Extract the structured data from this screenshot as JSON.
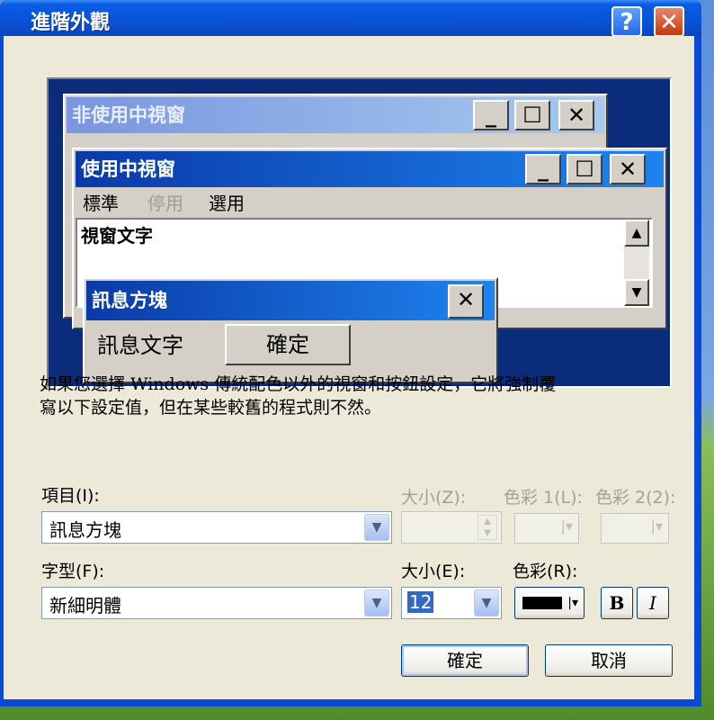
{
  "dialog": {
    "title": "進階外觀"
  },
  "preview": {
    "inactive_title": "非使用中視窗",
    "active_title": "使用中視窗",
    "menu": {
      "normal": "標準",
      "disabled": "停用",
      "selected": "選用"
    },
    "window_text": "視窗文字",
    "msgbox_title": "訊息方塊",
    "msgbox_text": "訊息文字",
    "msgbox_ok": "確定"
  },
  "description": {
    "line1": "如果您選擇 Windows 傳統配色以外的視窗和按鈕設定，它將強制覆",
    "line2": "寫以下設定值，但在某些較舊的程式則不然。"
  },
  "item": {
    "label": "項目(I):",
    "value": "訊息方塊"
  },
  "item_size": {
    "label": "大小(Z):"
  },
  "color1": {
    "label": "色彩 1(L):"
  },
  "color2": {
    "label": "色彩 2(2):"
  },
  "font": {
    "label": "字型(F):",
    "value": "新細明體"
  },
  "font_size": {
    "label": "大小(E):",
    "value": "12"
  },
  "font_color": {
    "label": "色彩(R):",
    "value": "#000000"
  },
  "bold_label": "B",
  "italic_label": "I",
  "buttons": {
    "ok": "確定",
    "cancel": "取消"
  }
}
